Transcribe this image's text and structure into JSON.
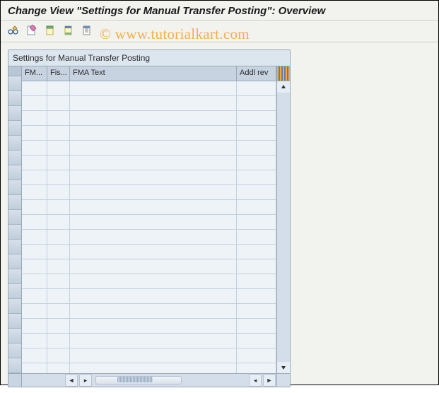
{
  "title": "Change View \"Settings for Manual Transfer Posting\": Overview",
  "watermark": "©  www.tutorialkart.com",
  "panel": {
    "title": "Settings for Manual Transfer Posting"
  },
  "columns": {
    "c0": "FM...",
    "c1": "Fis...",
    "c2": "FMA Text",
    "c3": "Addl rev"
  },
  "rowcount": 20
}
